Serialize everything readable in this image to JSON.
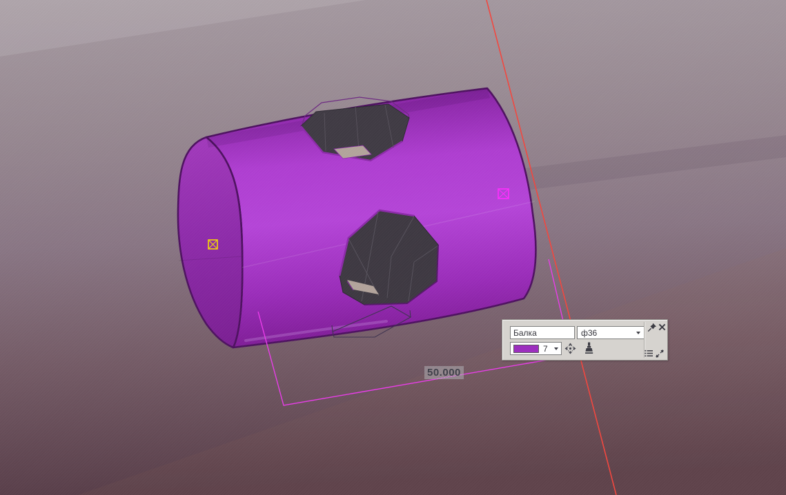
{
  "viewport": {
    "type": "3d-model-view",
    "selected_object": "beam-cylinder-with-holes",
    "dimension_label": {
      "text": "50.000"
    },
    "colors": {
      "background_top": "#a59aa1",
      "background_bottom": "#593f4a",
      "beam_body": "#ae3ed0",
      "beam_cap": "#8e2caa",
      "beam_edge": "#4e1260",
      "hole_interior": "#3e3942",
      "axis_line": "#f2463e",
      "dimension_line": "#e93ce9",
      "handle_yellow": "#f6dc00",
      "handle_magenta": "#ff2cff"
    }
  },
  "mini_toolbar": {
    "name_field": {
      "value": "Балка"
    },
    "profile_combo": {
      "value": "ф36"
    },
    "color_combo": {
      "value": "7",
      "swatch_color": "#9c2fbe"
    },
    "icons": {
      "pin": "pushpin-icon",
      "close": "close-icon",
      "move": "move-icon",
      "paintbrush": "paintbrush-icon",
      "options": "options-list-icon",
      "collapse": "collapse-diagonal-icon"
    }
  }
}
